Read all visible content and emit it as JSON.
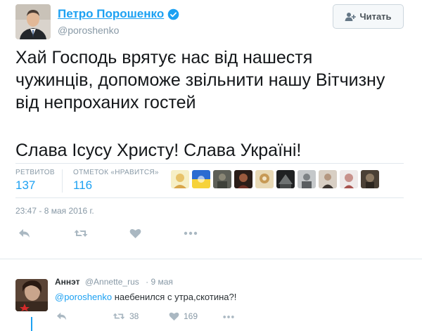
{
  "tweet": {
    "display_name": "Петро Порошенко",
    "handle": "@poroshenko",
    "follow_label": "Читать",
    "text_lines": [
      "Хай Господь врятує нас від нашестя",
      "чужинців, допоможе звільнити нашу Вітчизну",
      "від непроханих гостей",
      "Слава Ісусу Христу! Слава Україні!"
    ],
    "stats": {
      "retweets_label": "РЕТВИТОВ",
      "retweets_value": "137",
      "likes_label": "ОТМЕТОК «НРАВИТСЯ»",
      "likes_value": "116"
    },
    "timestamp": "23:47 - 8 мая 2016 г."
  },
  "reply": {
    "display_name": "Аннэт",
    "handle": "@Annette_rus",
    "time": "· 9 мая",
    "mention": "@poroshenko",
    "text": " наебенился с утра,скотина?!",
    "retweet_count": "38",
    "like_count": "169"
  },
  "colors": {
    "link_blue": "#1da1f2",
    "muted_gray": "#8899a6",
    "divider": "#e1e8ed"
  },
  "icons": [
    "verified-badge-icon",
    "follow-person-icon",
    "reply-icon",
    "retweet-icon",
    "heart-icon",
    "more-icon"
  ]
}
